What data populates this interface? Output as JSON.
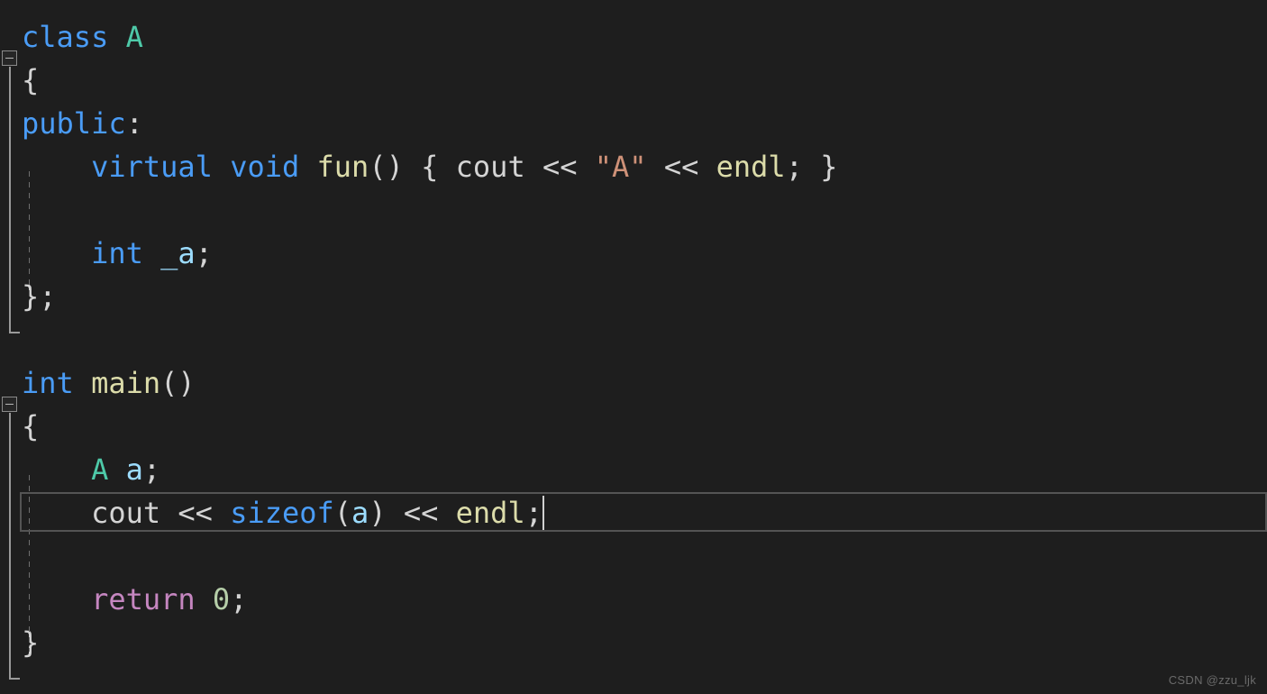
{
  "editor": {
    "language": "C++",
    "theme": "dark",
    "background_color": "#1e1e1e",
    "default_text_color": "#d4d4d4",
    "font_size_px": 32,
    "line_height_px": 48,
    "current_line_number": 12,
    "cursor_line_text": "    cout << sizeof(a) << endl;",
    "cursor_column": 30
  },
  "colors": {
    "keyword": "#4a9cf6",
    "type_name": "#4ec9a8",
    "function": "#dcdcaa",
    "string": "#ce9178",
    "variable": "#9cdcfe",
    "control": "#c586c0",
    "number": "#b5cea8",
    "plain": "#d4d4d4",
    "fold_marker": "#8a8a8a",
    "indent_guide": "#6f6f6f",
    "current_line_border": "#545454",
    "caret": "#d0d0d0",
    "watermark": "#6a6a6a"
  },
  "lines": [
    {
      "n": 1,
      "text": "class A",
      "tokens": [
        {
          "t": "class",
          "c": "tok-key"
        },
        {
          "t": " ",
          "c": "tok-plain"
        },
        {
          "t": "A",
          "c": "tok-type"
        }
      ]
    },
    {
      "n": 2,
      "text": "{",
      "tokens": [
        {
          "t": "{",
          "c": "tok-plain"
        }
      ]
    },
    {
      "n": 3,
      "text": "public:",
      "tokens": [
        {
          "t": "public",
          "c": "tok-key"
        },
        {
          "t": ":",
          "c": "tok-plain"
        }
      ]
    },
    {
      "n": 4,
      "text": "    virtual void fun() { cout << \"A\" << endl; }",
      "tokens": [
        {
          "t": "    ",
          "c": "tok-plain"
        },
        {
          "t": "virtual",
          "c": "tok-key"
        },
        {
          "t": " ",
          "c": "tok-plain"
        },
        {
          "t": "void",
          "c": "tok-key"
        },
        {
          "t": " ",
          "c": "tok-plain"
        },
        {
          "t": "fun",
          "c": "tok-fn"
        },
        {
          "t": "() { ",
          "c": "tok-plain"
        },
        {
          "t": "cout",
          "c": "tok-plain"
        },
        {
          "t": " ",
          "c": "tok-plain"
        },
        {
          "t": "<<",
          "c": "tok-op"
        },
        {
          "t": " ",
          "c": "tok-plain"
        },
        {
          "t": "\"A\"",
          "c": "tok-str"
        },
        {
          "t": " ",
          "c": "tok-plain"
        },
        {
          "t": "<<",
          "c": "tok-op"
        },
        {
          "t": " ",
          "c": "tok-plain"
        },
        {
          "t": "endl",
          "c": "tok-macro"
        },
        {
          "t": "; }",
          "c": "tok-plain"
        }
      ]
    },
    {
      "n": 5,
      "text": "",
      "tokens": []
    },
    {
      "n": 6,
      "text": "    int _a;",
      "tokens": [
        {
          "t": "    ",
          "c": "tok-plain"
        },
        {
          "t": "int",
          "c": "tok-key"
        },
        {
          "t": " ",
          "c": "tok-plain"
        },
        {
          "t": "_a",
          "c": "tok-var"
        },
        {
          "t": ";",
          "c": "tok-plain"
        }
      ]
    },
    {
      "n": 7,
      "text": "};",
      "tokens": [
        {
          "t": "};",
          "c": "tok-plain"
        }
      ]
    },
    {
      "n": 8,
      "text": "",
      "tokens": []
    },
    {
      "n": 9,
      "text": "int main()",
      "tokens": [
        {
          "t": "int",
          "c": "tok-key"
        },
        {
          "t": " ",
          "c": "tok-plain"
        },
        {
          "t": "main",
          "c": "tok-fn"
        },
        {
          "t": "()",
          "c": "tok-plain"
        }
      ]
    },
    {
      "n": 10,
      "text": "{",
      "tokens": [
        {
          "t": "{",
          "c": "tok-plain"
        }
      ]
    },
    {
      "n": 11,
      "text": "    A a;",
      "tokens": [
        {
          "t": "    ",
          "c": "tok-plain"
        },
        {
          "t": "A",
          "c": "tok-type"
        },
        {
          "t": " ",
          "c": "tok-plain"
        },
        {
          "t": "a",
          "c": "tok-var"
        },
        {
          "t": ";",
          "c": "tok-plain"
        }
      ]
    },
    {
      "n": 12,
      "text": "    cout << sizeof(a) << endl;",
      "tokens": [
        {
          "t": "    ",
          "c": "tok-plain"
        },
        {
          "t": "cout",
          "c": "tok-plain"
        },
        {
          "t": " ",
          "c": "tok-plain"
        },
        {
          "t": "<<",
          "c": "tok-op"
        },
        {
          "t": " ",
          "c": "tok-plain"
        },
        {
          "t": "sizeof",
          "c": "tok-key"
        },
        {
          "t": "(",
          "c": "tok-plain"
        },
        {
          "t": "a",
          "c": "tok-var"
        },
        {
          "t": ")",
          "c": "tok-plain"
        },
        {
          "t": " ",
          "c": "tok-plain"
        },
        {
          "t": "<<",
          "c": "tok-op"
        },
        {
          "t": " ",
          "c": "tok-plain"
        },
        {
          "t": "endl",
          "c": "tok-macro"
        },
        {
          "t": ";",
          "c": "tok-plain"
        }
      ]
    },
    {
      "n": 13,
      "text": "",
      "tokens": []
    },
    {
      "n": 14,
      "text": "    return 0;",
      "tokens": [
        {
          "t": "    ",
          "c": "tok-plain"
        },
        {
          "t": "return",
          "c": "tok-ctrl"
        },
        {
          "t": " ",
          "c": "tok-plain"
        },
        {
          "t": "0",
          "c": "tok-num"
        },
        {
          "t": ";",
          "c": "tok-plain"
        }
      ]
    },
    {
      "n": 15,
      "text": "}",
      "tokens": [
        {
          "t": "}",
          "c": "tok-plain"
        }
      ]
    }
  ],
  "fold_markers": [
    {
      "name": "fold-marker-class-a",
      "state": "expanded",
      "line": 1,
      "glyph": "minus"
    },
    {
      "name": "fold-marker-main",
      "state": "expanded",
      "line": 9,
      "glyph": "minus"
    }
  ],
  "watermark": {
    "text": "CSDN @zzu_ljk"
  }
}
